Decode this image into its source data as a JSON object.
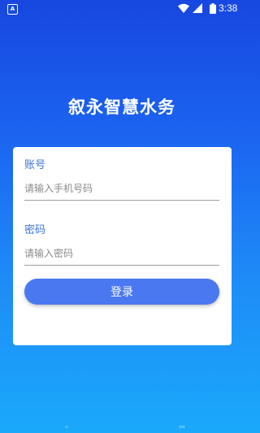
{
  "status_bar": {
    "app_icon_letter": "A",
    "time": "3:38"
  },
  "app": {
    "title": "叙永智慧水务"
  },
  "login_form": {
    "account_label": "账号",
    "account_placeholder": "请输入手机号码",
    "account_value": "",
    "password_label": "密码",
    "password_placeholder": "请输入密码",
    "password_value": "",
    "submit_label": "登录"
  },
  "colors": {
    "gradient_top": "#1747e0",
    "gradient_bottom": "#1aa9fb",
    "label_blue": "#3b73d6",
    "button_blue": "#4a78f0"
  },
  "icons": [
    "app-notification-icon",
    "wifi-icon",
    "signal-icon",
    "battery-icon"
  ]
}
